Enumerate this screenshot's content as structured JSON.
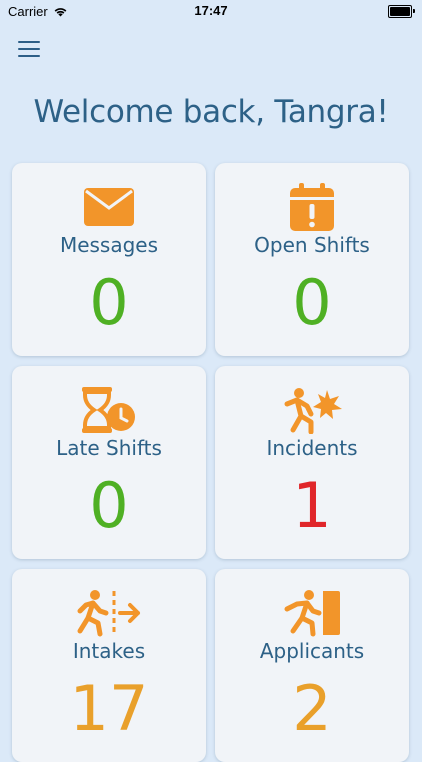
{
  "status_bar": {
    "carrier": "Carrier",
    "time": "17:47"
  },
  "header": {
    "welcome": "Welcome back, Tangra!"
  },
  "colors": {
    "accent_orange": "#f2952a",
    "title_blue": "#2d6187",
    "count_green": "#4fb024",
    "count_red": "#e0262a",
    "count_orange": "#e9a02b"
  },
  "dashboard": {
    "cards": [
      {
        "label": "Messages",
        "count": "0",
        "icon": "envelope-icon"
      },
      {
        "label": "Open Shifts",
        "count": "0",
        "icon": "calendar-alert-icon"
      },
      {
        "label": "Late Shifts",
        "count": "0",
        "icon": "hourglass-clock-icon"
      },
      {
        "label": "Incidents",
        "count": "1",
        "icon": "person-falling-icon"
      },
      {
        "label": "Intakes",
        "count": "17",
        "icon": "person-walking-arrow-icon"
      },
      {
        "label": "Applicants",
        "count": "2",
        "icon": "person-entering-door-icon"
      }
    ]
  }
}
